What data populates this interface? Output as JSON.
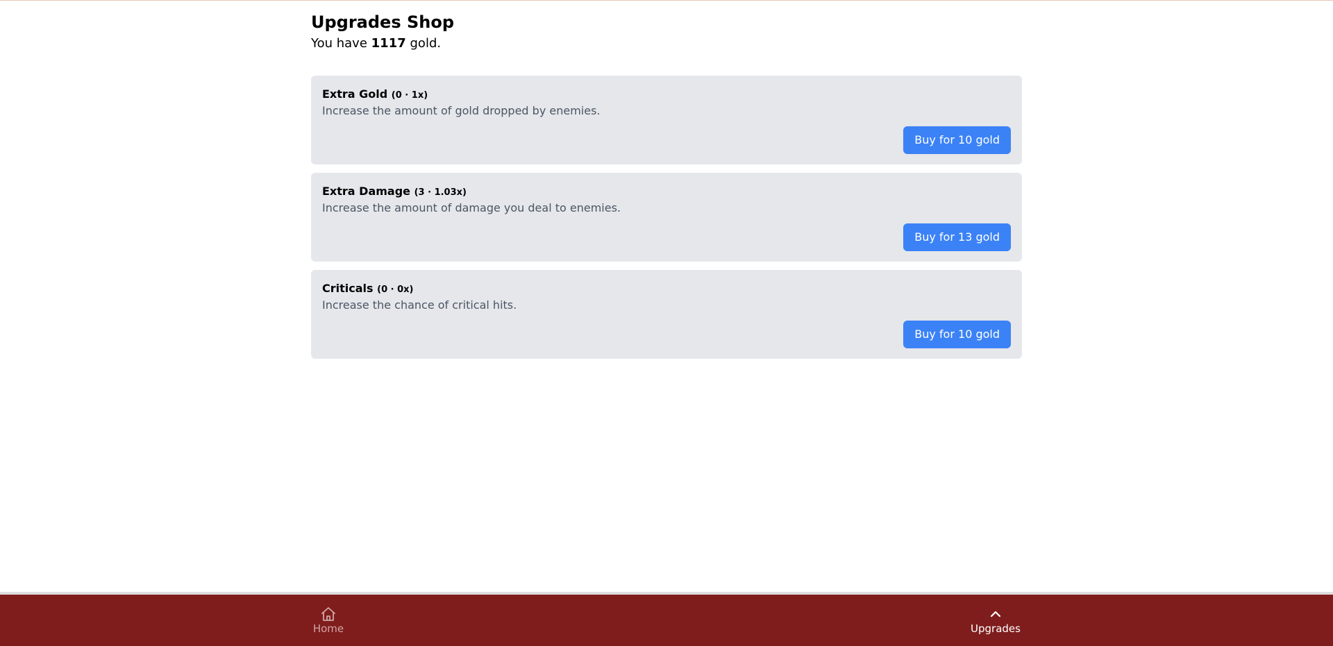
{
  "header": {
    "title": "Upgrades Shop",
    "gold_prefix": "You have",
    "gold_amount": "1117",
    "gold_suffix": "gold."
  },
  "upgrades": [
    {
      "name": "Extra Gold",
      "level": "(0 · 1x)",
      "description": "Increase the amount of gold dropped by enemies.",
      "buy_label": "Buy for 10 gold"
    },
    {
      "name": "Extra Damage",
      "level": "(3 · 1.03x)",
      "description": "Increase the amount of damage you deal to enemies.",
      "buy_label": "Buy for 13 gold"
    },
    {
      "name": "Criticals",
      "level": "(0 · 0x)",
      "description": "Increase the chance of critical hits.",
      "buy_label": "Buy for 10 gold"
    }
  ],
  "nav": {
    "home": {
      "label": "Home",
      "icon": "home-icon"
    },
    "upgrades": {
      "label": "Upgrades",
      "icon": "chevron-up-icon"
    }
  },
  "colors": {
    "nav_background": "#7f1d1d",
    "button": "#3b82f6",
    "card_background": "#e5e7eb"
  }
}
